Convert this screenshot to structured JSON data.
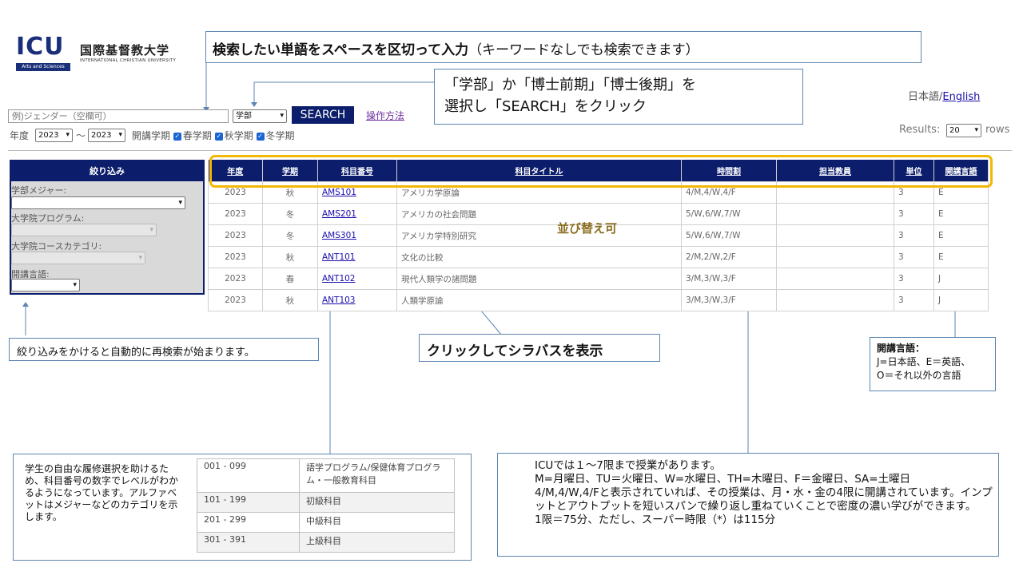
{
  "logo": {
    "mark": "ICU",
    "subtitle": "Arts and Sciences",
    "name_jp": "国際基督教大学",
    "name_en": "INTERNATIONAL CHRISTIAN UNIVERSITY"
  },
  "callouts": {
    "search_tip_bold": "検索したい単語をスペースを区切って入力",
    "search_tip_rest": "（キーワードなしでも検索できます）",
    "select_tip_line1": "「学部」か「博士前期」「博士後期」を",
    "select_tip_line2": "選択し「SEARCH」をクリック",
    "sort_tip": "並び替え可",
    "filter_tip": "絞り込みをかけると自動的に再検索が始まります。",
    "syllabus_tip": "クリックしてシラバスを表示",
    "lang_tip_title": "開講言語：",
    "lang_tip_line1": "J=日本語、E＝英語、",
    "lang_tip_line2": "O＝それ以外の言語",
    "level_tip": "学生の自由な履修選択を助けるため、科目番号の数字でレベルがわかるようになっています。アルファベットはメジャーなどのカテゴリを示します。",
    "period_tip": [
      "ICUでは１～7限まで授業があります。",
      "M=月曜日、TU＝火曜日、W=水曜日、TH=木曜日、F＝金曜日、SA=土曜日",
      "4/M,4/W,4/Fと表示されていれば、その授業は、月・水・金の4限に開講されています。インプットとアウトプットを短いスパンで繰り返し重ねていくことで密度の濃い学びができます。",
      "1限＝75分、ただし、スーパー時限（*）は115分"
    ]
  },
  "language": {
    "current": "日本語/",
    "link": "English"
  },
  "search": {
    "placeholder": "例)ジェンダー（空欄可）",
    "level_value": "学部",
    "button": "SEARCH",
    "help_link": "操作方法",
    "year_label": "年度",
    "year_from": "2023",
    "year_sep": "～",
    "year_to": "2023",
    "term_label": "開講学期",
    "terms": [
      "春学期",
      "秋学期",
      "冬学期"
    ],
    "results_label": "Results:",
    "results_value": "20",
    "results_unit": "rows"
  },
  "sidebar": {
    "title": "絞り込み",
    "filters": [
      "学部メジャー:",
      "大学院プログラム:",
      "大学院コースカテゴリ:",
      "開講言語:"
    ]
  },
  "table": {
    "headers": [
      "年度",
      "学期",
      "科目番号",
      "科目タイトル",
      "時間割",
      "担当教員",
      "単位",
      "開講言語"
    ],
    "rows": [
      [
        "2023",
        "秋",
        "AMS101",
        "アメリカ学原論",
        "4/M,4/W,4/F",
        "",
        "3",
        "E"
      ],
      [
        "2023",
        "冬",
        "AMS201",
        "アメリカの社会問題",
        "5/W,6/W,7/W",
        "",
        "3",
        "E"
      ],
      [
        "2023",
        "冬",
        "AMS301",
        "アメリカ学特別研究",
        "5/W,6/W,7/W",
        "",
        "3",
        "E"
      ],
      [
        "2023",
        "秋",
        "ANT101",
        "文化の比較",
        "2/M,2/W,2/F",
        "",
        "3",
        "E"
      ],
      [
        "2023",
        "春",
        "ANT102",
        "現代人類学の諸問題",
        "3/M,3/W,3/F",
        "",
        "3",
        "J"
      ],
      [
        "2023",
        "秋",
        "ANT103",
        "人類学原論",
        "3/M,3/W,3/F",
        "",
        "3",
        "J"
      ]
    ]
  },
  "levels": [
    [
      "001 - 099",
      "語学プログラム/保健体育プログラム・一般教育科目"
    ],
    [
      "101 - 199",
      "初級科目"
    ],
    [
      "201 - 299",
      "中級科目"
    ],
    [
      "301 - 391",
      "上級科目"
    ]
  ]
}
